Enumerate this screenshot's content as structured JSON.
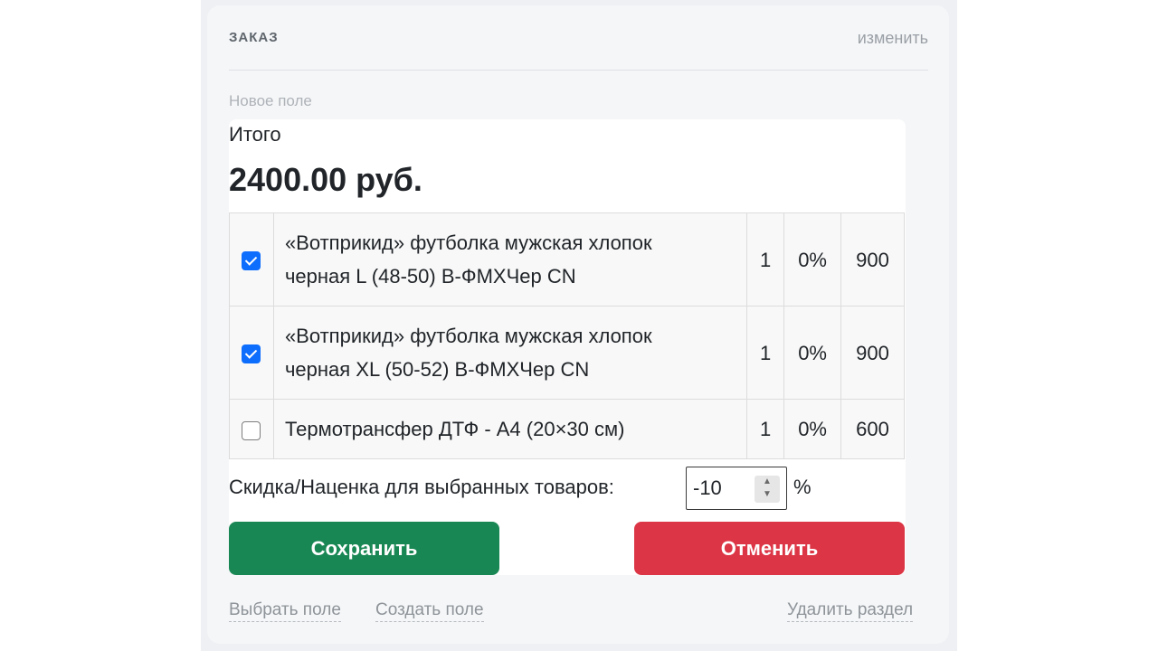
{
  "section": {
    "title": "ЗАКАЗ",
    "edit_link": "изменить",
    "field_label": "Новое поле"
  },
  "order": {
    "total_label": "Итого",
    "total_value": "2400.00 руб.",
    "items": [
      {
        "checked": true,
        "name_line1": "«Вотприкид» футболка мужская хлопок",
        "name_line2": "черная L (48-50) В-ФМХЧер CN",
        "qty": "1",
        "discount": "0%",
        "price": "900"
      },
      {
        "checked": true,
        "name_line1": "«Вотприкид» футболка мужская хлопок",
        "name_line2": "черная XL (50-52) В-ФМХЧер CN",
        "qty": "1",
        "discount": "0%",
        "price": "900"
      },
      {
        "checked": false,
        "name_line1": "Термотрансфер ДТФ - А4 (20×30 см)",
        "name_line2": "",
        "qty": "1",
        "discount": "0%",
        "price": "600"
      }
    ],
    "discount_label": "Скидка/Наценка для выбранных товаров:",
    "discount_value": "-10",
    "discount_unit": "%",
    "save_label": "Сохранить",
    "cancel_label": "Отменить"
  },
  "footer": {
    "select_field": "Выбрать поле",
    "create_field": "Создать поле",
    "delete_section": "Удалить раздел"
  },
  "colors": {
    "save": "#198754",
    "cancel": "#dc3545",
    "checkbox": "#0d6efd"
  }
}
